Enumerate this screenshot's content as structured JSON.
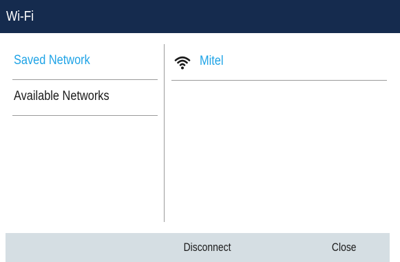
{
  "window": {
    "title": "Wi-Fi"
  },
  "menu": {
    "items": [
      {
        "label": "Saved Network",
        "selected": true
      },
      {
        "label": "Available Networks",
        "selected": false
      }
    ]
  },
  "networks": {
    "items": [
      {
        "name": "Mitel",
        "icon": "wifi-icon"
      }
    ]
  },
  "softkeys": {
    "disconnect_label": "Disconnect",
    "close_label": "Close"
  },
  "colors": {
    "title_bar": "#152b4e",
    "accent": "#1ea3e6",
    "softkey_bar": "#d5dee3"
  }
}
